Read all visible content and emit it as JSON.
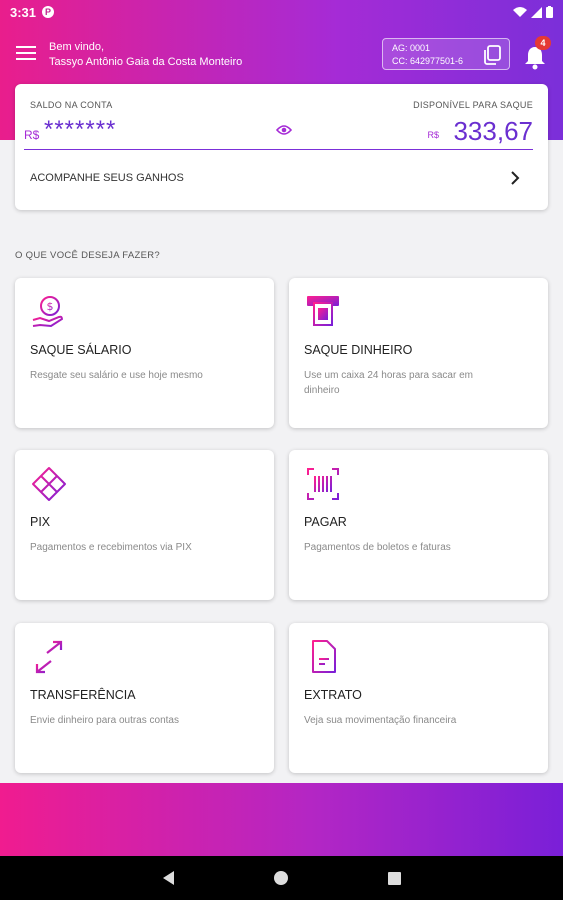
{
  "status_bar": {
    "time": "3:31",
    "app_badge": "P"
  },
  "header": {
    "welcome": "Bem vindo,",
    "user_name": "Tassyo Antônio Gaia da Costa Monteiro",
    "agency": "AG: 0001",
    "account": "CC: 642977501-6",
    "notification_count": "4"
  },
  "balance": {
    "label_left": "SALDO NA CONTA",
    "label_right": "DISPONÍVEL PARA SAQUE",
    "currency": "R$",
    "masked_value": "*******",
    "available_amount": "333,67",
    "earnings_link": "ACOMPANHE SEUS GANHOS"
  },
  "section_title": "O QUE VOCÊ DESEJA FAZER?",
  "actions": [
    {
      "title": "SAQUE SÁLARIO",
      "desc": "Resgate seu salário e use hoje mesmo",
      "icon": "salary-withdraw-icon"
    },
    {
      "title": "SAQUE DINHEIRO",
      "desc": "Use um caixa 24 horas para sacar em dinheiro",
      "icon": "atm-icon"
    },
    {
      "title": "PIX",
      "desc": "Pagamentos e recebimentos via PIX",
      "icon": "pix-icon"
    },
    {
      "title": "PAGAR",
      "desc": "Pagamentos de boletos e faturas",
      "icon": "barcode-icon"
    },
    {
      "title": "TRANSFERÊNCIA",
      "desc": "Envie dinheiro para outras contas",
      "icon": "transfer-icon"
    },
    {
      "title": "EXTRATO",
      "desc": "Veja sua movimentação financeira",
      "icon": "statement-icon"
    }
  ],
  "colors": {
    "primary": "#7b2fd9",
    "accent": "#e91e8c",
    "icon_gradient_start": "#ff1f8f",
    "icon_gradient_end": "#7a1fd8"
  }
}
